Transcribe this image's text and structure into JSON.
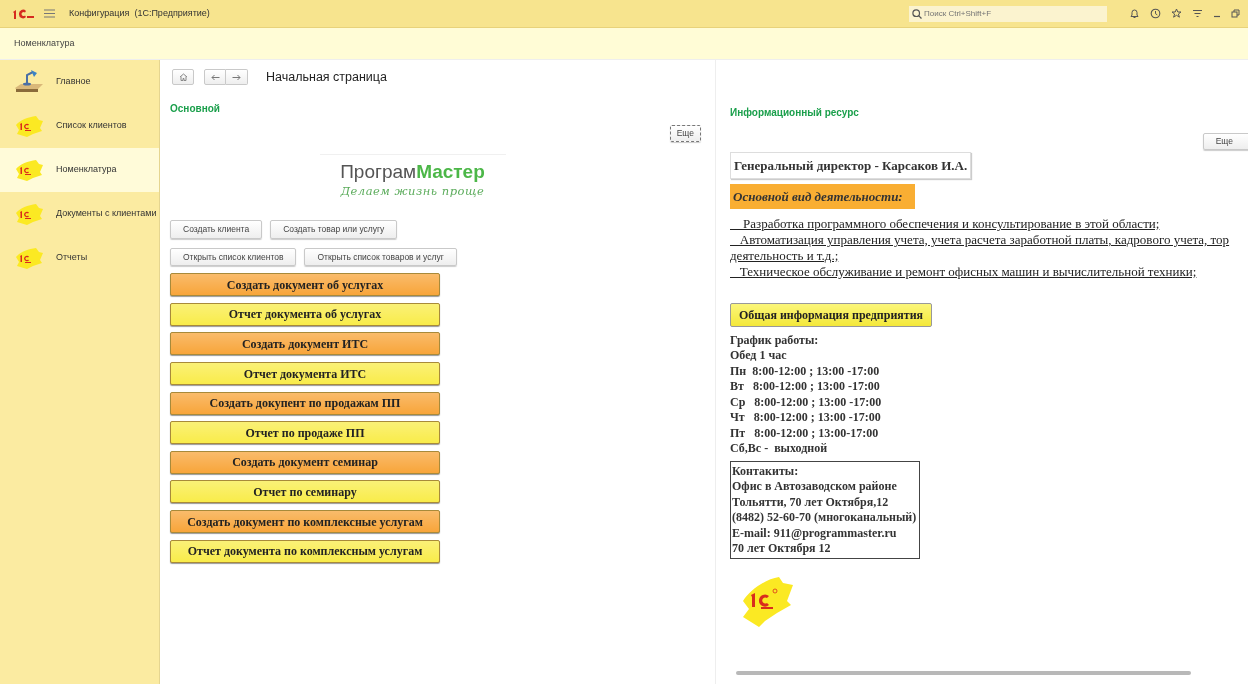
{
  "window": {
    "title": "Конфигурация  (1С:Предприятие)",
    "search": {
      "placeholder": "Поиск Ctrl+Shift+F"
    }
  },
  "section_title": "Номенклатура",
  "sidebar": {
    "items": [
      {
        "label": "Главное",
        "kind": "lamp",
        "selected": false
      },
      {
        "label": "Список клиентов",
        "kind": "logo",
        "selected": false
      },
      {
        "label": "Номенклатура",
        "kind": "logo",
        "selected": true
      },
      {
        "label": "Документы с клиентами",
        "kind": "logo",
        "selected": false
      },
      {
        "label": "Отчеты",
        "kind": "logo",
        "selected": false
      }
    ]
  },
  "page_title": "Начальная страница",
  "left": {
    "title": "Основной",
    "more": "Еще",
    "logo": {
      "part1": "Програм",
      "part2": "Мастер",
      "slogan": "Делаем жизнь проще"
    },
    "small_buttons": [
      [
        "Создать клиента",
        "Создать товар или услугу"
      ],
      [
        "Открыть список клиентов",
        "Открыть список товаров и услуг"
      ]
    ],
    "buttons": [
      {
        "label": "Создать документ об услугах",
        "color": "#f8a53a"
      },
      {
        "label": "Отчет документа об услугах",
        "color": "#f9ec4a"
      },
      {
        "label": "Создать документ ИТС",
        "color": "#f8a53a"
      },
      {
        "label": "Отчет документа ИТС",
        "color": "#f9ec4a"
      },
      {
        "label": "Создать докупент по продажам ПП",
        "color": "#f8a53a"
      },
      {
        "label": "Отчет по продаже ПП",
        "color": "#f9ec4a"
      },
      {
        "label": "Создать документ семинар",
        "color": "#f8a53a"
      },
      {
        "label": "Отчет по семинару",
        "color": "#f9ec4a"
      },
      {
        "label": "Создать документ по комплексные услугам",
        "color": "#f8a53a"
      },
      {
        "label": "Отчет документа по комплексным услугам",
        "color": "#f9ec4a"
      }
    ]
  },
  "right": {
    "title": "Информационный ресурс",
    "more": "Еще",
    "director": "Генеральный директор - Карсаков И.А.",
    "activity_heading": "Основной вид деятельности:",
    "activities": [
      "    Разработка программного обеспечения и консультирование в этой области;",
      "   Автоматизация управления учета, учета расчета заработной платы, кадрового учета, тор",
      "деятельность и т.д.;",
      "   Техническое обслуживание и ремонт офисных машин и вычислительной техники;"
    ],
    "info_button": "Общая информация предприятия",
    "schedule": [
      "График работы:",
      "Обед 1 час",
      "Пн  8:00-12:00 ; 13:00 -17:00",
      "Вт   8:00-12:00 ; 13:00 -17:00",
      "Ср   8:00-12:00 ; 13:00 -17:00",
      "Чт   8:00-12:00 ; 13:00 -17:00",
      "Пт   8:00-12:00 ; 13:00-17:00",
      "Сб,Вс -  выходной"
    ],
    "contacts": [
      "Контакиты:",
      "Офис в Автозаводском районе",
      "Тольятти, 70 лет Октября,12",
      "(8482) 52-60-70 (многоканальный)",
      "E-mail: 911@programmaster.ru",
      "70 лет Октября 12"
    ]
  }
}
